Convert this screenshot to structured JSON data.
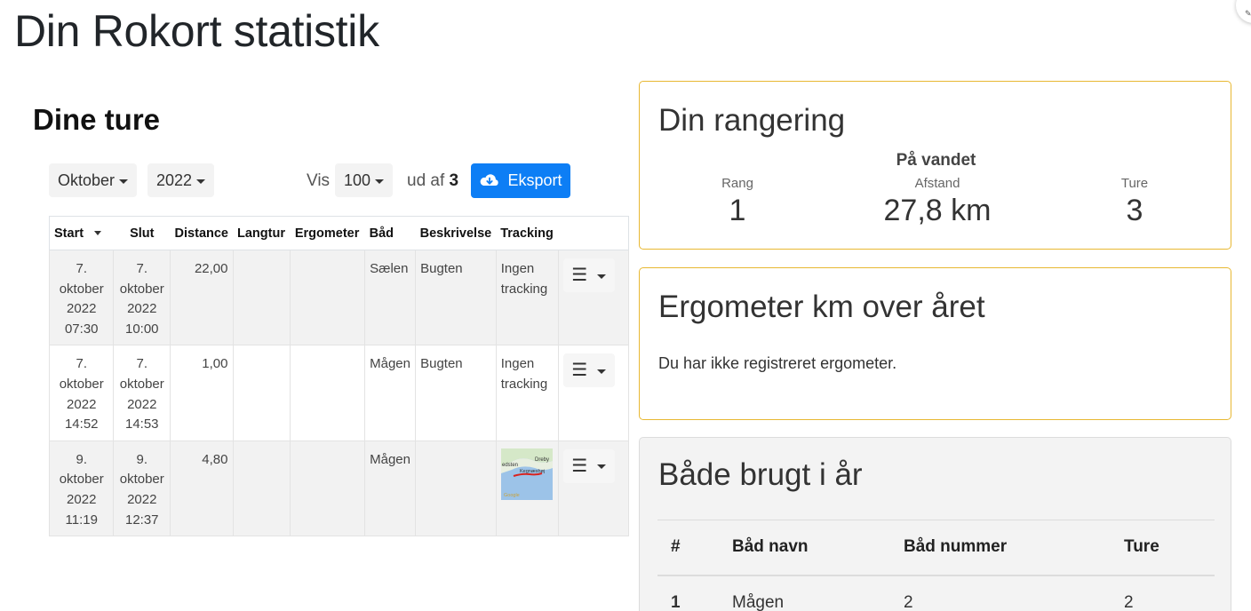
{
  "page": {
    "title": "Din Rokort statistik"
  },
  "trips_section": {
    "title": "Dine ture",
    "month_select": "Oktober",
    "year_select": "2022",
    "vis_label": "Vis",
    "vis_select": "100",
    "ud_af_label": "ud af",
    "total_count": "3",
    "export_label": "Eksport",
    "columns": [
      "Start",
      "Slut",
      "Distance",
      "Langtur",
      "Ergometer",
      "Båd",
      "Beskrivelse",
      "Tracking"
    ],
    "rows": [
      {
        "start": [
          "7.",
          "oktober",
          "2022",
          "07:30"
        ],
        "end": [
          "7.",
          "oktober",
          "2022",
          "10:00"
        ],
        "distance": "22,00",
        "langtur": "",
        "ergometer": "",
        "boat": "Sælen",
        "description": "Bugten",
        "tracking": [
          "Ingen",
          "tracking"
        ],
        "has_map": false
      },
      {
        "start": [
          "7.",
          "oktober",
          "2022",
          "14:52"
        ],
        "end": [
          "7.",
          "oktober",
          "2022",
          "14:53"
        ],
        "distance": "1,00",
        "langtur": "",
        "ergometer": "",
        "boat": "Mågen",
        "description": "Bugten",
        "tracking": [
          "Ingen",
          "tracking"
        ],
        "has_map": false
      },
      {
        "start": [
          "9.",
          "oktober",
          "2022",
          "11:19"
        ],
        "end": [
          "9.",
          "oktober",
          "2022",
          "12:37"
        ],
        "distance": "4,80",
        "langtur": "",
        "ergometer": "",
        "boat": "Mågen",
        "description": "",
        "tracking": [],
        "has_map": true
      }
    ],
    "map_labels": [
      "edsten",
      "Dreby",
      "Kegnæshøj",
      "Google"
    ]
  },
  "ranking": {
    "title": "Din rangering",
    "subtitle": "På vandet",
    "rang_label": "Rang",
    "rang_value": "1",
    "afstand_label": "Afstand",
    "afstand_value": "27,8 km",
    "ture_label": "Ture",
    "ture_value": "3"
  },
  "ergometer": {
    "title": "Ergometer km over året",
    "message": "Du har ikke registreret ergometer."
  },
  "boats": {
    "title": "Både brugt i år",
    "columns": [
      "#",
      "Båd navn",
      "Båd nummer",
      "Ture"
    ],
    "rows": [
      [
        "1",
        "Mågen",
        "2",
        "2"
      ]
    ]
  },
  "colors": {
    "accent": "#0d7ef5",
    "card_border": "#e8b832"
  }
}
